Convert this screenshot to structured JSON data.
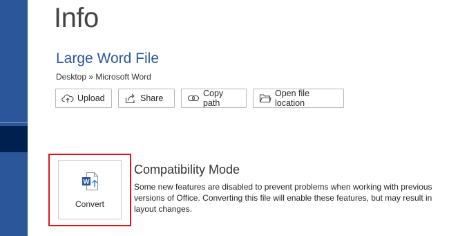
{
  "page": {
    "title": "Info"
  },
  "document": {
    "name": "Large Word File",
    "breadcrumb": "Desktop » Microsoft Word"
  },
  "actions": {
    "upload": {
      "label": "Upload",
      "icon": "cloud-upload-icon"
    },
    "share": {
      "label": "Share",
      "icon": "share-icon"
    },
    "copy_path": {
      "label": "Copy path",
      "icon": "link-icon"
    },
    "open_location": {
      "label": "Open file location",
      "icon": "folder-icon"
    }
  },
  "compatibility": {
    "button_label": "Convert",
    "button_icon": "word-document-upgrade-icon",
    "title": "Compatibility Mode",
    "description": "Some new features are disabled to prevent problems when working with previous versions of Office. Converting this file will enable these features, but may result in layout changes."
  },
  "colors": {
    "sidebar": "#2b579a",
    "sidebar_selected": "#002050",
    "accent": "#2b579a",
    "highlight_border": "#e0151b"
  }
}
